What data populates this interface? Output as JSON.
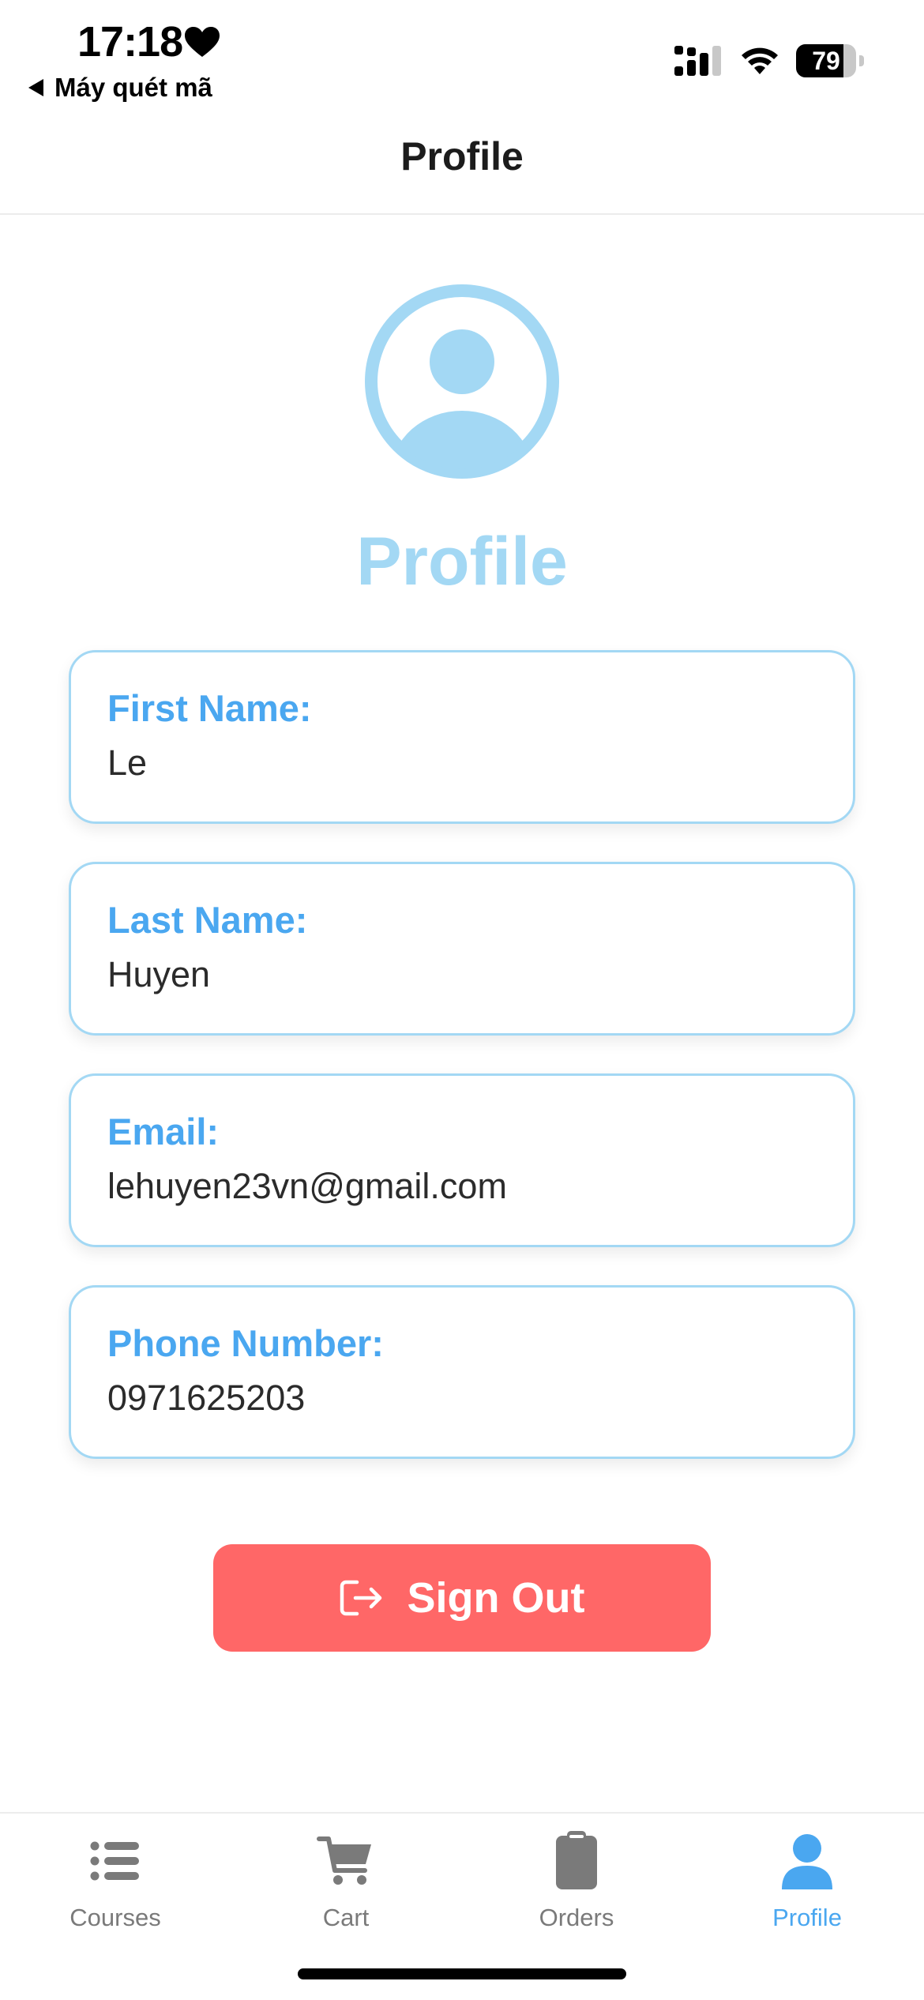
{
  "status_bar": {
    "time": "17:18",
    "back_app": "Máy quét mã",
    "battery_percent": "79",
    "battery_level": 0.79
  },
  "header": {
    "title": "Profile"
  },
  "profile": {
    "heading": "Profile",
    "fields": [
      {
        "label": "First Name:",
        "value": "Le"
      },
      {
        "label": "Last Name:",
        "value": "Huyen"
      },
      {
        "label": "Email:",
        "value": "lehuyen23vn@gmail.com"
      },
      {
        "label": "Phone Number:",
        "value": "0971625203"
      }
    ],
    "avatar_icon": "user-circle-icon"
  },
  "actions": {
    "sign_out_label": "Sign Out",
    "sign_out_icon": "sign-out-icon"
  },
  "tabs": [
    {
      "label": "Courses",
      "icon": "list-icon",
      "active": false
    },
    {
      "label": "Cart",
      "icon": "cart-icon",
      "active": false
    },
    {
      "label": "Orders",
      "icon": "clipboard-icon",
      "active": false
    },
    {
      "label": "Profile",
      "icon": "person-icon",
      "active": true
    }
  ],
  "colors": {
    "accent": "#4aa7f0",
    "avatar": "#a3d8f4",
    "card_border": "#a3d8f4",
    "sign_out": "#ff6767",
    "tab_inactive": "#7a7a7a"
  }
}
